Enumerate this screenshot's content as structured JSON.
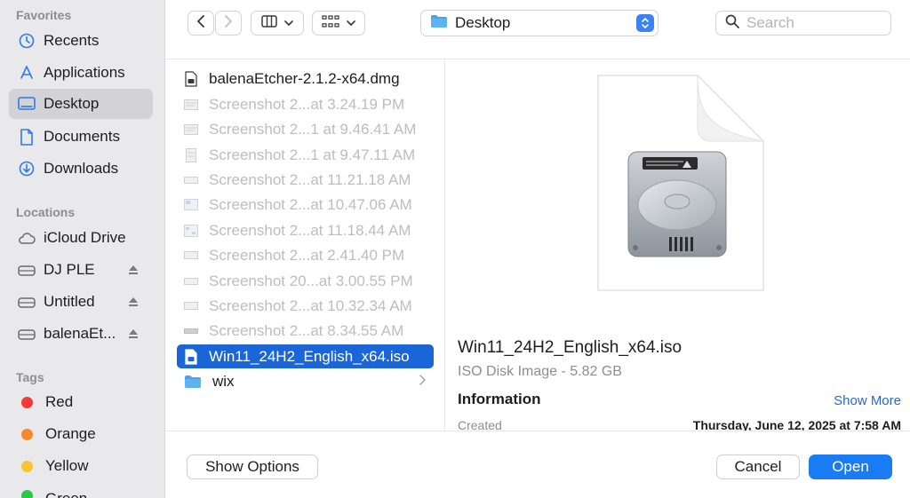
{
  "sidebar": {
    "favorites_title": "Favorites",
    "favorites": [
      {
        "label": "Recents",
        "icon": "clock-icon"
      },
      {
        "label": "Applications",
        "icon": "applications-icon"
      },
      {
        "label": "Desktop",
        "icon": "desktop-icon",
        "active": true
      },
      {
        "label": "Documents",
        "icon": "document-icon"
      },
      {
        "label": "Downloads",
        "icon": "download-icon"
      }
    ],
    "locations_title": "Locations",
    "locations": [
      {
        "label": "iCloud Drive",
        "icon": "cloud-icon"
      },
      {
        "label": "DJ PLE",
        "icon": "drive-icon",
        "eject": true
      },
      {
        "label": "Untitled",
        "icon": "drive-icon",
        "eject": true
      },
      {
        "label": "balenaEt...",
        "icon": "drive-icon",
        "eject": true
      }
    ],
    "tags_title": "Tags",
    "tags": [
      {
        "label": "Red",
        "color": "#f23b36"
      },
      {
        "label": "Orange",
        "color": "#f6892c"
      },
      {
        "label": "Yellow",
        "color": "#f7c52e"
      },
      {
        "label": "Green",
        "color": "#2fc44c"
      }
    ]
  },
  "toolbar": {
    "location_label": "Desktop",
    "search_placeholder": "Search"
  },
  "files": [
    {
      "name": "balenaEtcher-2.1.2-x64.dmg",
      "state": "normal"
    },
    {
      "name": "Screenshot 2...at 3.24.19 PM",
      "state": "dim"
    },
    {
      "name": "Screenshot 2...1 at 9.46.41 AM",
      "state": "dim"
    },
    {
      "name": "Screenshot 2...1 at 9.47.11 AM",
      "state": "dim"
    },
    {
      "name": "Screenshot 2...at 11.21.18 AM",
      "state": "dim"
    },
    {
      "name": "Screenshot 2...at 10.47.06 AM",
      "state": "dim"
    },
    {
      "name": "Screenshot 2...at 11.18.44 AM",
      "state": "dim"
    },
    {
      "name": "Screenshot 2...at 2.41.40 PM",
      "state": "dim"
    },
    {
      "name": "Screenshot 20...at 3.00.55 PM",
      "state": "dim"
    },
    {
      "name": "Screenshot 2...at 10.32.34 AM",
      "state": "dim"
    },
    {
      "name": "Screenshot 2...at 8.34.55 AM",
      "state": "dim"
    },
    {
      "name": "Win11_24H2_English_x64.iso",
      "state": "selected"
    },
    {
      "name": "wix",
      "state": "folder"
    }
  ],
  "preview": {
    "name": "Win11_24H2_English_x64.iso",
    "kind": "ISO Disk Image - 5.82 GB",
    "info_title": "Information",
    "show_more": "Show More",
    "created_label": "Created",
    "created_value": "Thursday, June 12, 2025 at 7:58 AM"
  },
  "buttons": {
    "show_options": "Show Options",
    "cancel": "Cancel",
    "open": "Open"
  },
  "colors": {
    "accent": "#1a7cf5",
    "selection": "#1a66d9"
  }
}
